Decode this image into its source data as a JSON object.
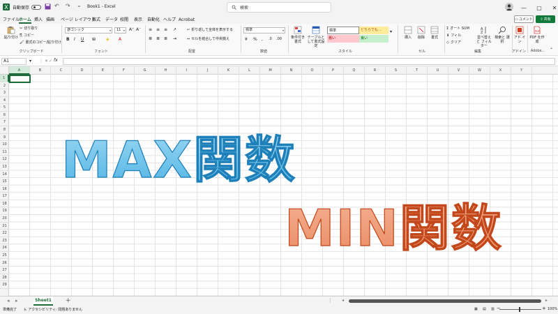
{
  "titlebar": {
    "autosave_label": "自動保存",
    "book_title": "Book1 - Excel",
    "search_placeholder": "検索"
  },
  "tabs": [
    "ファイル",
    "ホーム",
    "挿入",
    "描画",
    "ページ レイアウト",
    "数式",
    "データ",
    "校閲",
    "表示",
    "自動化",
    "ヘルプ",
    "Acrobat"
  ],
  "active_tab": "ホーム",
  "buttons": {
    "comment": "コメント",
    "share": "共有"
  },
  "ribbon": {
    "clipboard": {
      "paste": "貼り付け",
      "cut": "切り取り",
      "copy": "コピー",
      "format_painter": "書式のコピー/貼り付け",
      "label": "クリップボード"
    },
    "font": {
      "name": "游ゴシック",
      "size": "11",
      "label": "フォント"
    },
    "alignment": {
      "wrap": "折り返して全体を表示する",
      "merge": "セルを結合して中央揃え",
      "label": "配置"
    },
    "number": {
      "format": "標準",
      "label": "数値"
    },
    "styles": {
      "conditional": "条件付き書式",
      "table": "テーブルとして書式設定",
      "standard": "標準",
      "neutral": "どちらでも...",
      "bad": "悪い",
      "good": "良い",
      "label": "スタイル"
    },
    "cells": {
      "insert": "挿入",
      "delete": "削除",
      "format": "書式",
      "label": "セル"
    },
    "editing": {
      "autosum": "オート SUM",
      "fill": "フィル",
      "clear": "クリア",
      "sort": "並べ替えと フィルター",
      "find": "検索と 選択",
      "label": "編集"
    },
    "addins": {
      "addin": "アド イン",
      "label": "アドイン"
    },
    "adobe": {
      "pdf": "PDF を作成",
      "label": "Adobe..."
    }
  },
  "formula_bar": {
    "name_box": "A1",
    "fx": "fx",
    "value": ""
  },
  "columns": [
    "A",
    "B",
    "C",
    "D",
    "E",
    "F",
    "G",
    "H",
    "I",
    "J",
    "K",
    "L",
    "M",
    "N",
    "O",
    "P",
    "Q",
    "R",
    "S",
    "T",
    "U",
    "V",
    "W",
    "X",
    "Y"
  ],
  "rows": [
    "1",
    "2",
    "3",
    "4",
    "5",
    "6",
    "7",
    "8",
    "9",
    "10",
    "11",
    "12",
    "13",
    "14",
    "15",
    "16",
    "17",
    "18",
    "19",
    "20",
    "21",
    "22",
    "23",
    "24",
    "25",
    "26",
    "27",
    "28",
    "29"
  ],
  "selected_cell": "A1",
  "overlay": {
    "max_text": "MAX関数",
    "min_text": "MIN関数"
  },
  "sheets": [
    "Sheet1"
  ],
  "status": {
    "ready": "準備完了",
    "accessibility": "アクセシビリティ: 問題ありません",
    "zoom": "100%"
  },
  "colors": {
    "excel_green": "#1e6b3a",
    "max_fill": "#6cc8ee",
    "max_stroke": "#1f7fb8",
    "min_fill": "#ea8a61",
    "min_stroke": "#c2481b",
    "share_green": "#117a3b"
  }
}
